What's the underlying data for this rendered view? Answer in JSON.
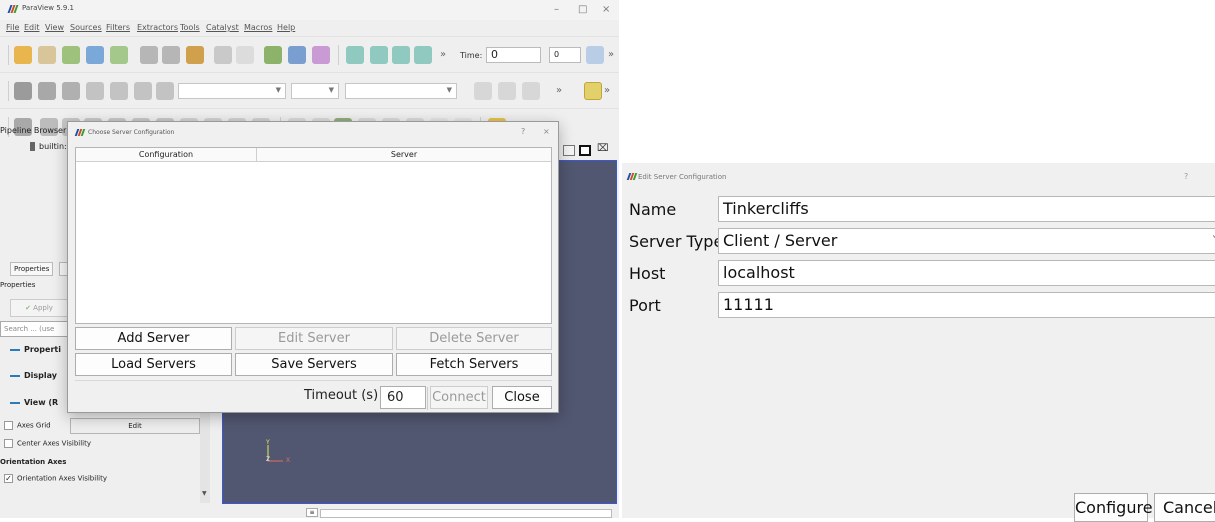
{
  "app": {
    "title": "ParaView 5.9.1",
    "menus": [
      "File",
      "Edit",
      "View",
      "Sources",
      "Filters",
      "Extractors",
      "Tools",
      "Catalyst",
      "Macros",
      "Help"
    ],
    "time_label": "Time:",
    "time_value": "0",
    "timestep_value": "0"
  },
  "left_panel": {
    "pipeline_browser_label": "Pipeline Browser",
    "builtin_label": "builtin:",
    "properties_tab": "Properties",
    "properties_label": "Properties",
    "apply_label": "Apply",
    "search_placeholder": "Search ... (use",
    "section_properties": "Properti",
    "section_display": "Display",
    "section_view": "View (R",
    "axes_grid_label": "Axes Grid",
    "axes_grid_button": "Edit",
    "center_axes_label": "Center Axes Visibility",
    "orientation_axes_header": "Orientation Axes",
    "orientation_axes_visibility_label": "Orientation Axes Visibility"
  },
  "viewport": {
    "axis_y": "Y",
    "axis_z": "Z",
    "axis_x": "X"
  },
  "choose_server_dialog": {
    "title": "Choose Server Configuration",
    "help_glyph": "?",
    "close_glyph": "×",
    "columns": [
      "Configuration",
      "Server"
    ],
    "add_server": "Add Server",
    "edit_server": "Edit Server",
    "delete_server": "Delete Server",
    "load_servers": "Load Servers",
    "save_servers": "Save Servers",
    "fetch_servers": "Fetch Servers",
    "timeout_label": "Timeout (s)",
    "timeout_value": "60",
    "connect": "Connect",
    "close": "Close"
  },
  "edit_server_dialog": {
    "title": "Edit Server Configuration",
    "help_glyph": "?",
    "name_label": "Name",
    "name_value": "Tinkercliffs",
    "server_type_label": "Server Type",
    "server_type_value": "Client / Server",
    "host_label": "Host",
    "host_value": "localhost",
    "port_label": "Port",
    "port_value": "11111",
    "configure": "Configure",
    "cancel": "Cancel"
  },
  "colors": {
    "viewport_bg": "#525771",
    "viewport_border": "#3d56d6",
    "accent": "#2b7bb9"
  }
}
